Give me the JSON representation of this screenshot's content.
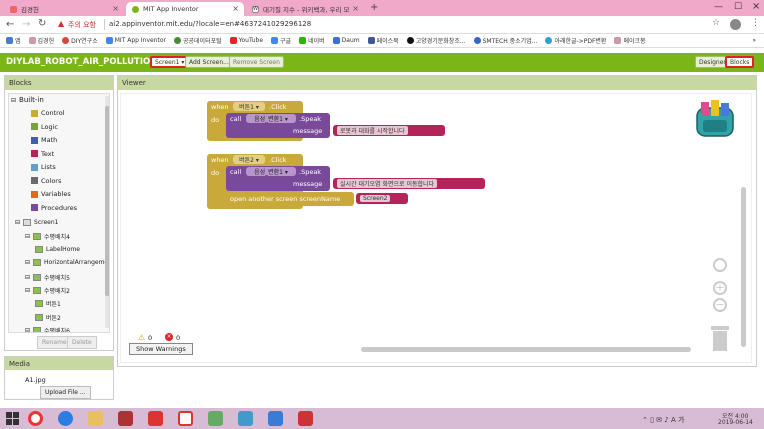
{
  "browser": {
    "tabs": [
      {
        "label": "김경헌"
      },
      {
        "label": "MIT App Inventor"
      },
      {
        "label": "대기질 지수 - 위키백과, 우리 모"
      }
    ],
    "new_tab": "+",
    "security_label": "주의 요함",
    "url": "ai2.appinventor.mit.edu/?locale=en#4637241029296128",
    "bookmarks": [
      "앱",
      "김경헌",
      "DIY연구소",
      "MIT App Inventor",
      "공공데이터포털",
      "YouTube",
      "구글",
      "네이버",
      "Daum",
      "페이스북",
      "고양경기문화창조...",
      "SMTECH 중소기업...",
      "아래한글->PDF변환",
      "메이크봉"
    ],
    "more": "»"
  },
  "app": {
    "project_title": "DIYLAB_ROBOT_AIR_POLLUTION2",
    "screen_select": "Screen1 ▾",
    "add_screen": "Add Screen...",
    "remove_screen": "Remove Screen",
    "designer": "Designer",
    "blocks": "Blocks"
  },
  "blocks_panel": {
    "title": "Blocks",
    "builtin": "Built-in",
    "builtin_items": [
      {
        "label": "Control",
        "color": "#c8a93a"
      },
      {
        "label": "Logic",
        "color": "#7aa43b"
      },
      {
        "label": "Math",
        "color": "#3f5fa8"
      },
      {
        "label": "Text",
        "color": "#b3255a"
      },
      {
        "label": "Lists",
        "color": "#63a0c8"
      },
      {
        "label": "Colors",
        "color": "#6a6a6a"
      },
      {
        "label": "Variables",
        "color": "#d66b2a"
      },
      {
        "label": "Procedures",
        "color": "#7a4a9a"
      }
    ],
    "tree": [
      {
        "label": "Screen1",
        "level": 0
      },
      {
        "label": "수평배치4",
        "level": 1
      },
      {
        "label": "LabelHome",
        "level": 2
      },
      {
        "label": "HorizontalArrangemen",
        "level": 1
      },
      {
        "label": "수평배치5",
        "level": 1
      },
      {
        "label": "수평배치2",
        "level": 1
      },
      {
        "label": "버튼1",
        "level": 2
      },
      {
        "label": "버튼2",
        "level": 2
      },
      {
        "label": "수평배치6",
        "level": 1
      }
    ],
    "rename": "Rename",
    "delete": "Delete"
  },
  "media_panel": {
    "title": "Media",
    "file": "A1.jpg",
    "upload": "Upload File ..."
  },
  "viewer": {
    "title": "Viewer",
    "warnings_count": "0",
    "errors_count": "0",
    "show_warnings": "Show Warnings",
    "block1": {
      "when": "when",
      "component": "버튼1 ▾",
      "event": ".Click",
      "do": "do",
      "call": "call",
      "tts": "음성_변환1 ▾",
      "method": ".Speak",
      "message_label": "message",
      "message": "로봇과 대화를 시작합니다"
    },
    "block2": {
      "when": "when",
      "component": "버튼2 ▾",
      "event": ".Click",
      "do": "do",
      "call": "call",
      "tts": "음성_변환1 ▾",
      "method": ".Speak",
      "message_label": "message",
      "message": "실시간 대기오염 화면으로 이동합니다",
      "open_screen": "open another screen  screenName",
      "screen_name": "Screen2"
    }
  },
  "taskbar": {
    "time": "오전 4:00",
    "date": "2019-06-14"
  }
}
